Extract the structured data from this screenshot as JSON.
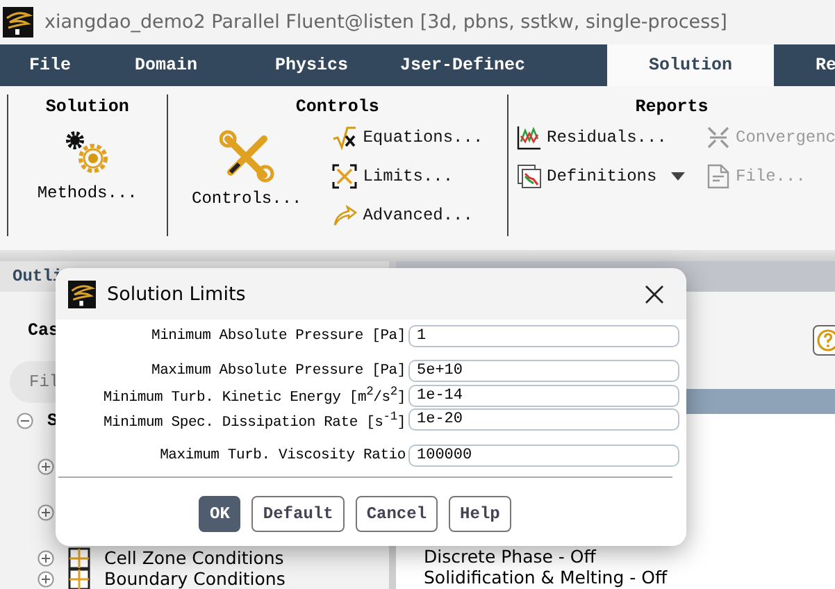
{
  "window": {
    "title": "xiangdao_demo2 Parallel Fluent@listen  [3d, pbns, sstkw, single-process]"
  },
  "menu_tabs": [
    {
      "label": "File",
      "selected": false
    },
    {
      "label": "Domain",
      "selected": false
    },
    {
      "label": "Physics",
      "selected": false
    },
    {
      "label": "Jser-Definec",
      "selected": false
    },
    {
      "label": "Solution",
      "selected": true
    },
    {
      "label": "Re",
      "selected": false
    }
  ],
  "ribbon": {
    "solution_group": {
      "title": "Solution",
      "button": "Methods..."
    },
    "controls_group": {
      "title": "Controls",
      "button": "Controls...",
      "items": [
        {
          "kind": "sqrt",
          "label": "Equations..."
        },
        {
          "kind": "limits",
          "label": "Limits..."
        },
        {
          "kind": "arrow",
          "label": "Advanced..."
        }
      ]
    },
    "reports_group": {
      "title": "Reports",
      "items": [
        {
          "kind": "residuals",
          "label": "Residuals...",
          "disabled": false,
          "dropdown": false
        },
        {
          "kind": "convergence",
          "label": "Convergenc",
          "disabled": true,
          "dropdown": false
        },
        {
          "kind": "definitions",
          "label": "Definitions",
          "disabled": false,
          "dropdown": true
        },
        {
          "kind": "file",
          "label": "File...",
          "disabled": true,
          "dropdown": false
        }
      ]
    }
  },
  "outline": {
    "header": "Outli",
    "section": "Cas",
    "filter": {
      "placeholder": "Fil"
    },
    "tree": [
      {
        "label": "S",
        "expanded": true
      },
      {
        "expanded": false
      },
      {
        "expanded": false
      },
      {
        "label": "Cell Zone Conditions",
        "expanded": false
      },
      {
        "label": "Boundary Conditions",
        "expanded": false
      }
    ]
  },
  "task_page": {
    "lines": [
      "Discrete Phase - Off",
      "Solidification & Melting - Off"
    ]
  },
  "dialog": {
    "title": "Solution Limits",
    "fields": [
      {
        "label": "Minimum Absolute Pressure [Pa]",
        "value": "1"
      },
      {
        "label": "Maximum Absolute Pressure [Pa]",
        "value": "5e+10"
      },
      {
        "label": "Minimum Turb. Kinetic Energy [m$^{2}$/s$^{2}$]",
        "value": "1e-14"
      },
      {
        "label": "Minimum Spec. Dissipation Rate [s$^{-1}$]",
        "value": "1e-20"
      },
      {
        "label": "Maximum Turb. Viscosity Ratio",
        "value": "100000"
      }
    ],
    "buttons": [
      {
        "label": "OK",
        "primary": true
      },
      {
        "label": "Default",
        "primary": false
      },
      {
        "label": "Cancel",
        "primary": false
      },
      {
        "label": "Help",
        "primary": false
      }
    ]
  }
}
